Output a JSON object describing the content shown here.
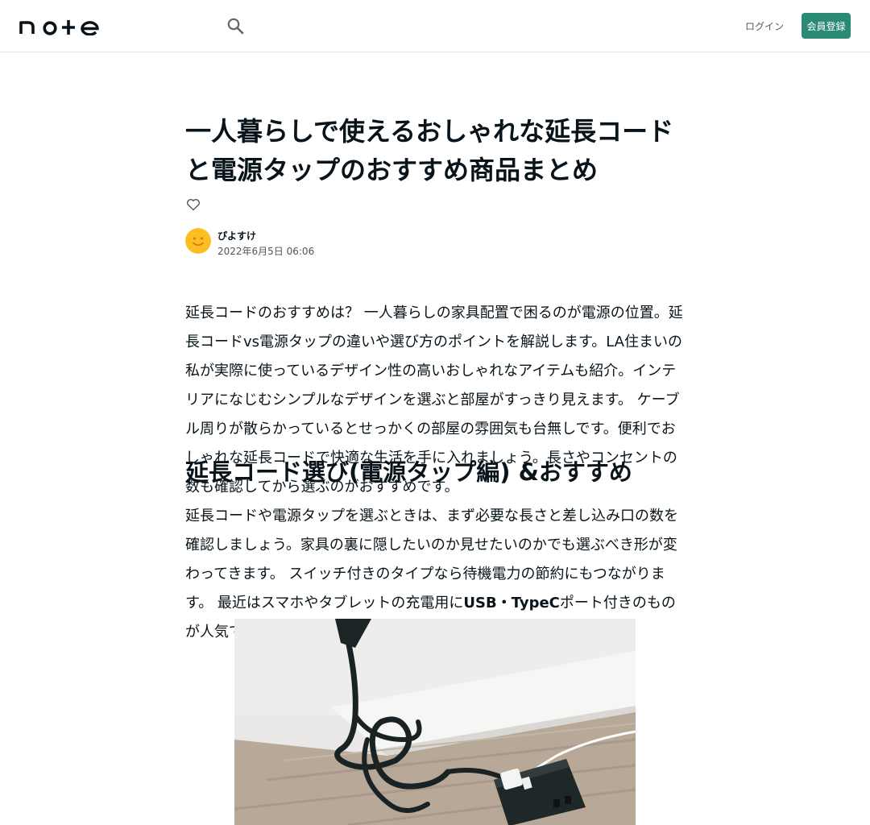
{
  "header": {
    "logo_text": "note",
    "login_label": "ログイン",
    "signup_label": "会員登録"
  },
  "article": {
    "title": "一人暮らしで使えるおしゃれな延長コードと電源タップのおすすめ商品まとめ",
    "author_name": "ぴよすけ",
    "date": "2022年6月5日 06:06",
    "intro": "延長コードのおすすめは？ 一人暮らしの家具配置で困るのが電源の位置。延長コードvs電源タップの違いや選び方のポイントを解説します。LA住まいの私が実際に使っているデザイン性の高いおしゃれなアイテムも紹介。インテリアになじむシンプルなデザインを選ぶと部屋がすっきり見えます。 ケーブル周りが散らかっているとせっかくの部屋の雰囲気も台無しです。便利でおしゃれな延長コードで快適な生活を手に入れましょう。長さやコンセントの数も確認してから選ぶのがおすすめです。",
    "section_heading": "延長コード選び(電源タップ編) &おすすめ",
    "section_text_a": "延長コードや電源タップを選ぶときは、まず必要な長さと差し込み口の数を確認しましょう。家具の裏に隠したいのか見せたいのかでも選ぶべき形が変わってきます。 スイッチ付きのタイプなら待機電力の節約にもつながります。 最近はスマホやタブレットの充電用に",
    "section_text_bold": "USB・TypeC",
    "section_text_b": "ポート付きのものが人気でとても便利なのでおすすめです。",
    "image_alt": "延長コードの写真"
  },
  "colors": {
    "brand_green": "#2b8a73",
    "text": "#08131a",
    "avatar": "#fbbf24"
  },
  "icons": [
    "search-icon",
    "heart-icon",
    "smiley-avatar-icon"
  ]
}
